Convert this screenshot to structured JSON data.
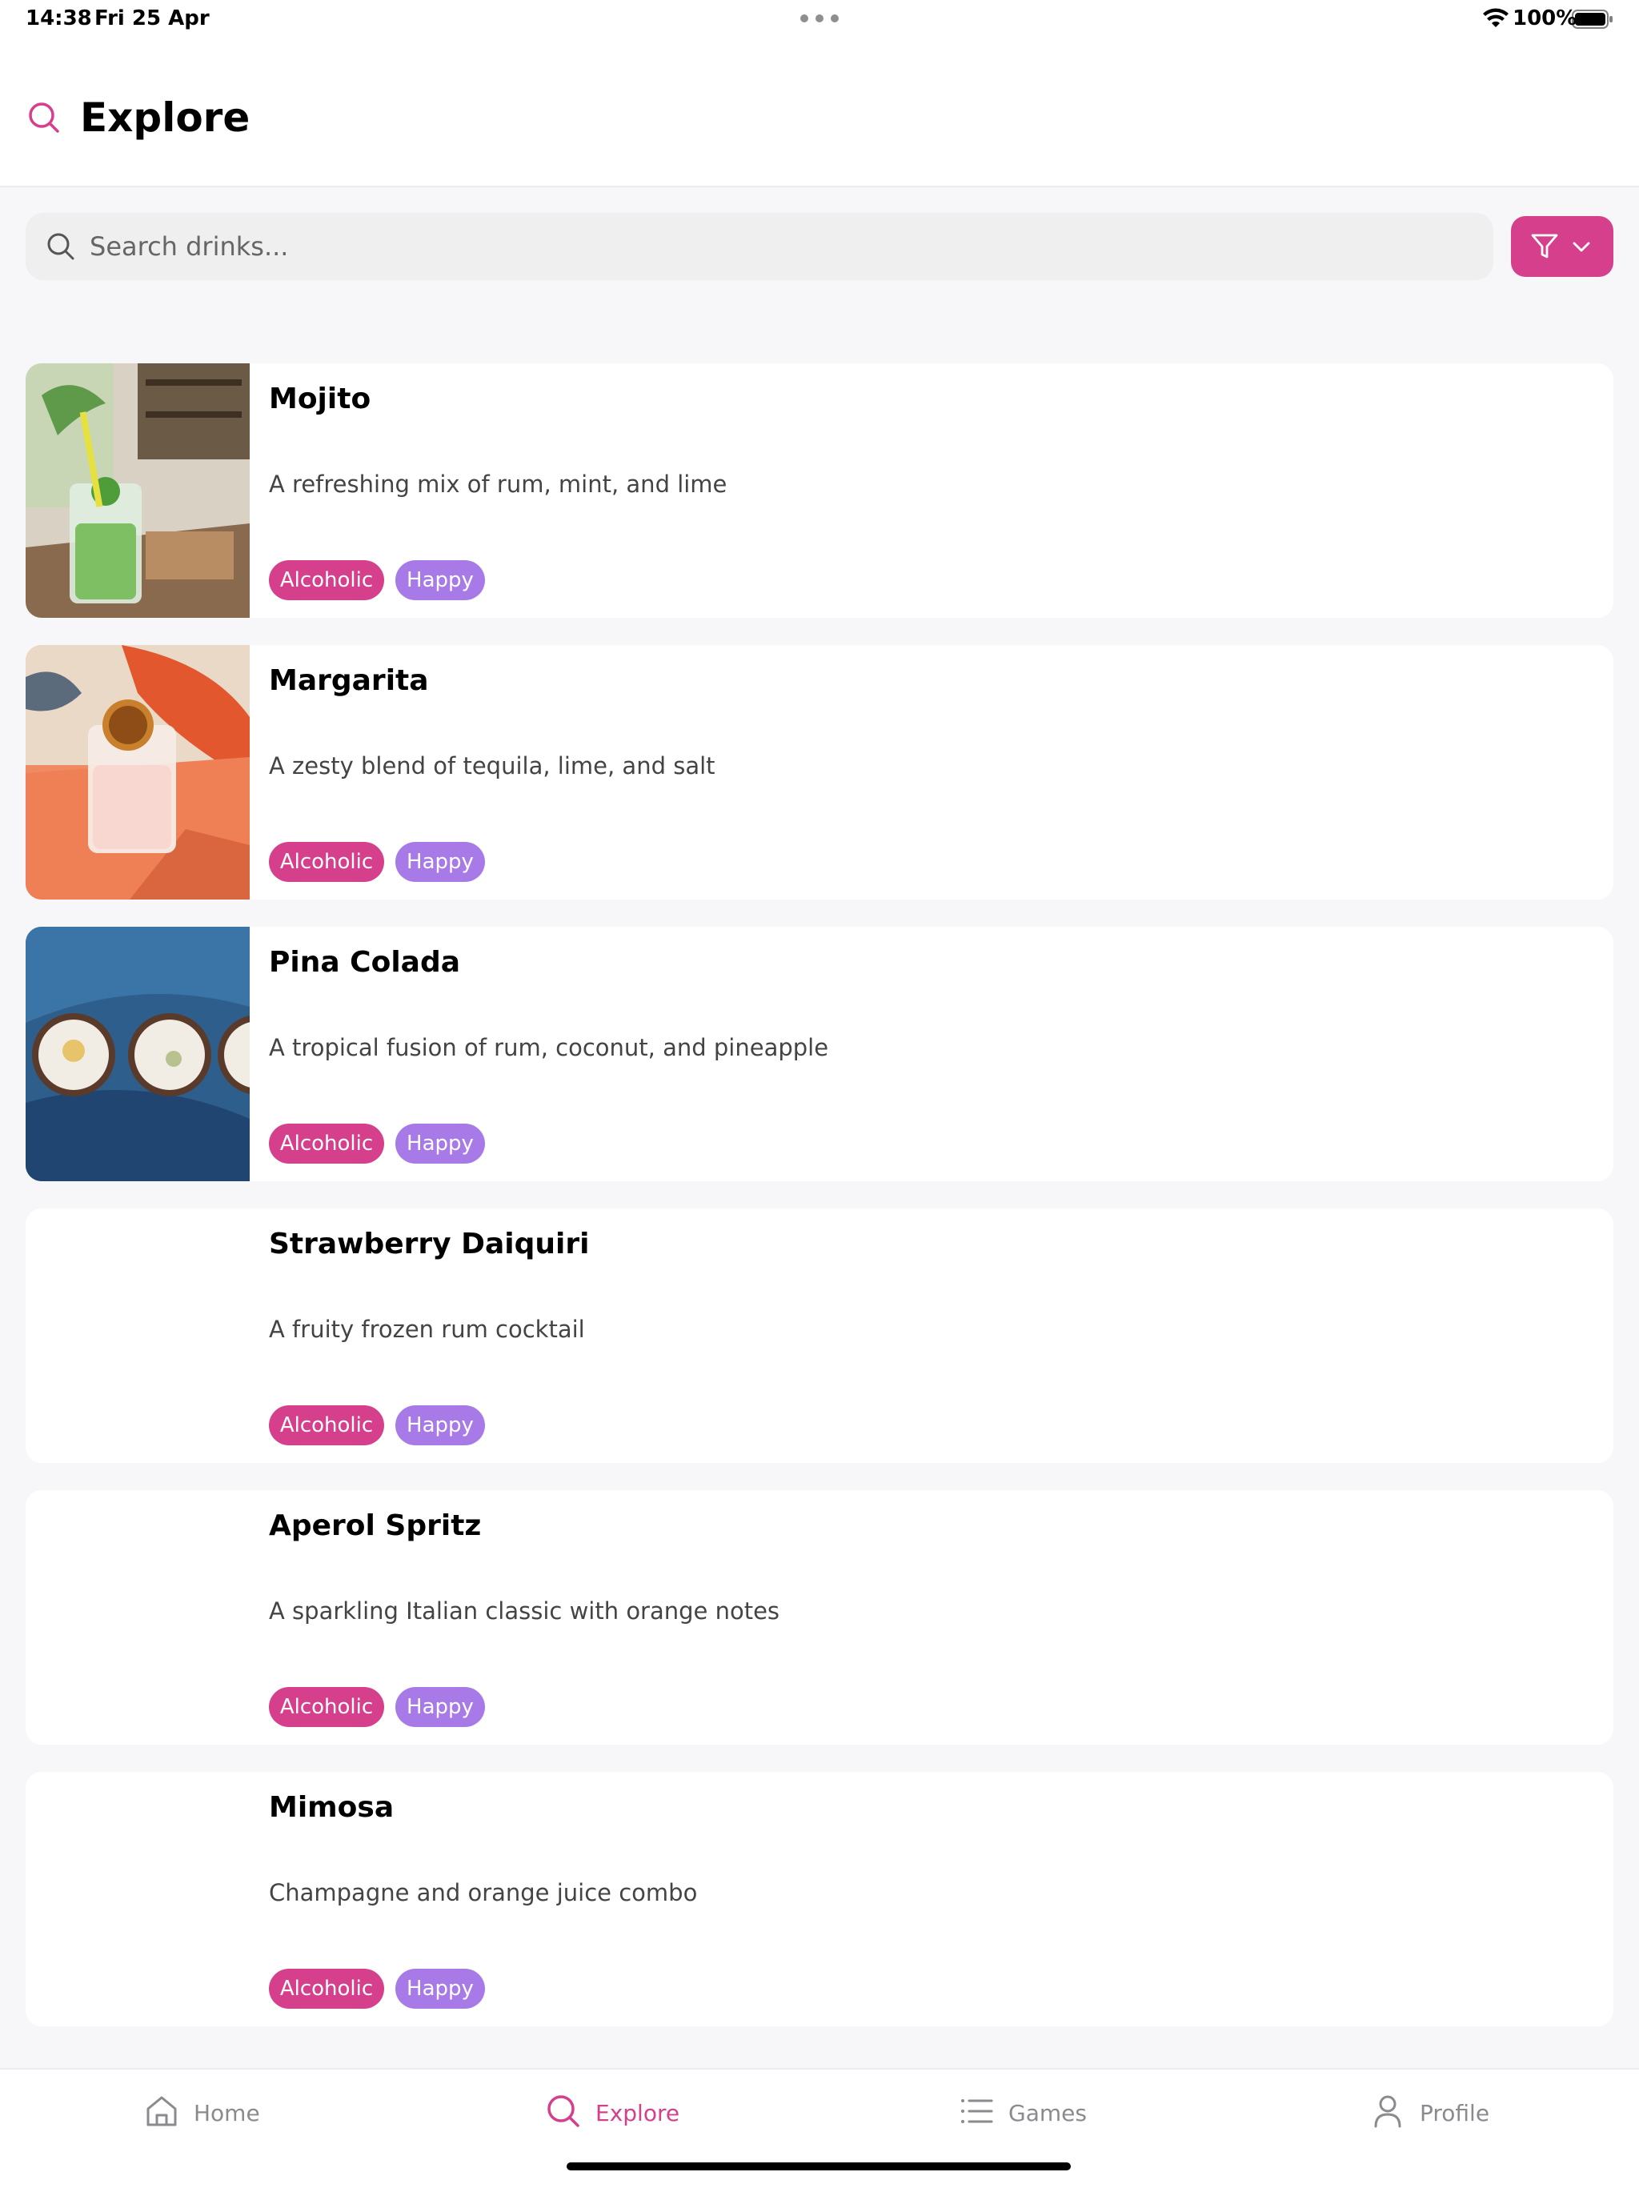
{
  "status_bar": {
    "time": "14:38",
    "date": "Fri 25 Apr",
    "battery": "100%"
  },
  "header": {
    "title": "Explore",
    "icon": "search-icon"
  },
  "search": {
    "placeholder": "Search drinks...",
    "value": ""
  },
  "filter_button": {
    "icons": [
      "filter-icon",
      "chevron-down-icon"
    ]
  },
  "colors": {
    "accent": "#d63f8c",
    "tag_alcoholic": "#d63f8c",
    "tag_happy": "#a87ae8"
  },
  "drinks": [
    {
      "name": "Mojito",
      "description": "A refreshing mix of rum, mint, and lime",
      "tags": [
        "Alcoholic",
        "Happy"
      ]
    },
    {
      "name": "Margarita",
      "description": "A zesty blend of tequila, lime, and salt",
      "tags": [
        "Alcoholic",
        "Happy"
      ]
    },
    {
      "name": "Pina Colada",
      "description": "A tropical fusion of rum, coconut, and pineapple",
      "tags": [
        "Alcoholic",
        "Happy"
      ]
    },
    {
      "name": "Strawberry Daiquiri",
      "description": "A fruity frozen rum cocktail",
      "tags": [
        "Alcoholic",
        "Happy"
      ]
    },
    {
      "name": "Aperol Spritz",
      "description": "A sparkling Italian classic with orange notes",
      "tags": [
        "Alcoholic",
        "Happy"
      ]
    },
    {
      "name": "Mimosa",
      "description": "Champagne and orange juice combo",
      "tags": [
        "Alcoholic",
        "Happy"
      ]
    }
  ],
  "tab_bar": {
    "tabs": [
      {
        "label": "Home",
        "icon": "home-icon",
        "active": false
      },
      {
        "label": "Explore",
        "icon": "search-icon",
        "active": true
      },
      {
        "label": "Games",
        "icon": "list-icon",
        "active": false
      },
      {
        "label": "Profile",
        "icon": "person-icon",
        "active": false
      }
    ]
  }
}
